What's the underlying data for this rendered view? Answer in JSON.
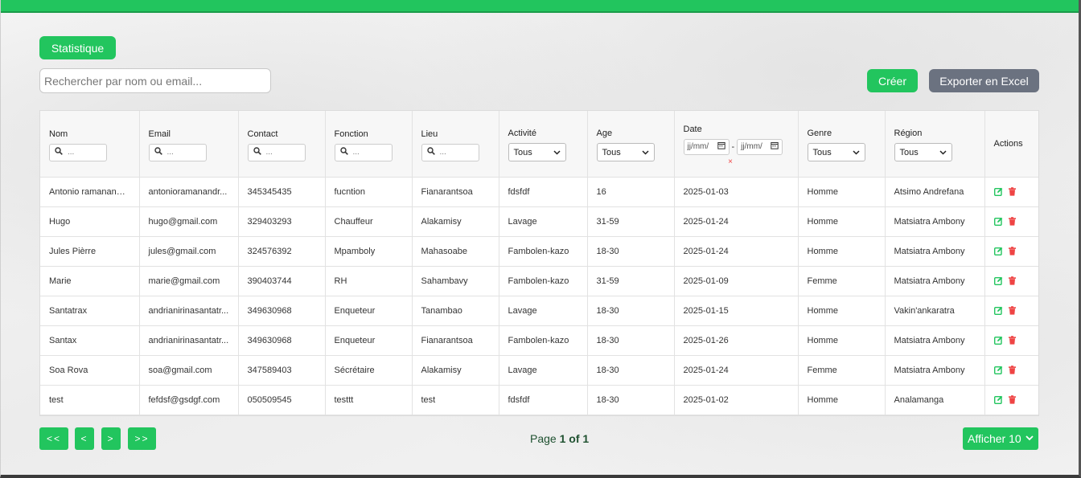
{
  "toolbar": {
    "stat_label": "Statistique",
    "search_placeholder": "Rechercher par nom ou email...",
    "create_label": "Créer",
    "export_label": "Exporter en Excel"
  },
  "colors": {
    "accent": "#22c55e",
    "export": "#6b7280",
    "danger": "#ef4444"
  },
  "table": {
    "headers": {
      "nom": "Nom",
      "email": "Email",
      "contact": "Contact",
      "fonction": "Fonction",
      "lieu": "Lieu",
      "activite": "Activité",
      "age": "Age",
      "date": "Date",
      "genre": "Genre",
      "region": "Région",
      "actions": "Actions"
    },
    "filters": {
      "text_placeholder": "...",
      "select_value": "Tous",
      "date_placeholder": "jj/mm/",
      "date_sep": "-",
      "clear": "×"
    },
    "rows": [
      [
        "Antonio ramanandr...",
        "antonioramanandr...",
        "345345435",
        "fucntion",
        "Fianarantsoa",
        "fdsfdf",
        "16",
        "2025-01-03",
        "Homme",
        "Atsimo Andrefana"
      ],
      [
        "Hugo",
        "hugo@gmail.com",
        "329403293",
        "Chauffeur",
        "Alakamisy",
        "Lavage",
        "31-59",
        "2025-01-24",
        "Homme",
        "Matsiatra Ambony"
      ],
      [
        "Jules Pièrre",
        "jules@gmail.com",
        "324576392",
        "Mpamboly",
        "Mahasoabe",
        "Fambolen-kazo",
        "18-30",
        "2025-01-24",
        "Homme",
        "Matsiatra Ambony"
      ],
      [
        "Marie",
        "marie@gmail.com",
        "390403744",
        "RH",
        "Sahambavy",
        "Fambolen-kazo",
        "31-59",
        "2025-01-09",
        "Femme",
        "Matsiatra Ambony"
      ],
      [
        "Santatrax",
        "andrianirinasantatr...",
        "349630968",
        "Enqueteur",
        "Tanambao",
        "Lavage",
        "18-30",
        "2025-01-15",
        "Homme",
        "Vakin'ankaratra"
      ],
      [
        "Santax",
        "andrianirinasantatr...",
        "349630968",
        "Enqueteur",
        "Fianarantsoa",
        "Fambolen-kazo",
        "18-30",
        "2025-01-26",
        "Homme",
        "Matsiatra Ambony"
      ],
      [
        "Soa Rova",
        "soa@gmail.com",
        "347589403",
        "Sécrétaire",
        "Alakamisy",
        "Lavage",
        "18-30",
        "2025-01-24",
        "Femme",
        "Matsiatra Ambony"
      ],
      [
        "test",
        "fefdsf@gsdgf.com",
        "050509545",
        "testtt",
        "test",
        "fdsfdf",
        "18-30",
        "2025-01-02",
        "Homme",
        "Analamanga"
      ]
    ]
  },
  "pagination": {
    "first": "<<",
    "prev": "<",
    "next": ">",
    "last": ">>",
    "page_prefix": "Page",
    "page_of": "1 of 1",
    "page_size_label": "Afficher 10"
  }
}
